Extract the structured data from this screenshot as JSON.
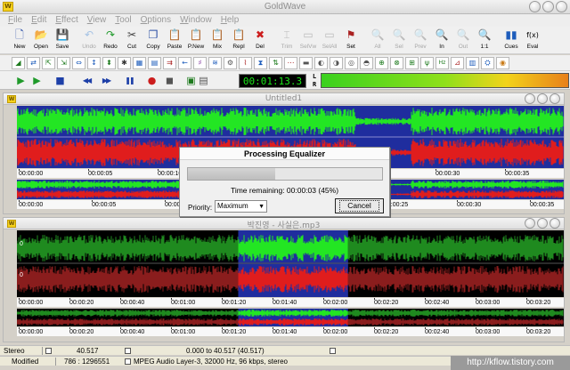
{
  "window": {
    "title": "GoldWave",
    "logo_text": "W"
  },
  "menu": [
    "File",
    "Edit",
    "Effect",
    "View",
    "Tool",
    "Options",
    "Window",
    "Help"
  ],
  "toolbar": [
    {
      "label": "New",
      "icon": "new-file-icon",
      "glyph": "🗋",
      "color": "#2c4fa8",
      "enabled": true
    },
    {
      "label": "Open",
      "icon": "open-folder-icon",
      "glyph": "📂",
      "color": "#d3a322",
      "enabled": true
    },
    {
      "label": "Save",
      "icon": "save-disk-icon",
      "glyph": "💾",
      "color": "#2b4fa5",
      "enabled": true
    },
    {
      "sep": true
    },
    {
      "label": "Undo",
      "icon": "undo-icon",
      "glyph": "↶",
      "color": "#1a6fd0",
      "enabled": false
    },
    {
      "label": "Redo",
      "icon": "redo-icon",
      "glyph": "↷",
      "color": "#1f9a2a",
      "enabled": true
    },
    {
      "label": "Cut",
      "icon": "scissors-icon",
      "glyph": "✂",
      "color": "#444444",
      "enabled": true
    },
    {
      "label": "Copy",
      "icon": "copy-icon",
      "glyph": "❐",
      "color": "#2b4fa5",
      "enabled": true
    },
    {
      "label": "Paste",
      "icon": "paste-icon",
      "glyph": "📋",
      "color": "#b87b25",
      "enabled": true
    },
    {
      "label": "P.New",
      "icon": "paste-new-icon",
      "glyph": "📋",
      "color": "#b87b25",
      "enabled": true
    },
    {
      "label": "Mix",
      "icon": "mix-icon",
      "glyph": "📋",
      "color": "#b03060",
      "enabled": true
    },
    {
      "label": "Repl",
      "icon": "replace-icon",
      "glyph": "📋",
      "color": "#7b2d9a",
      "enabled": true
    },
    {
      "label": "Del",
      "icon": "delete-icon",
      "glyph": "✖",
      "color": "#cc1d1d",
      "enabled": true
    },
    {
      "sep": true
    },
    {
      "label": "Trim",
      "icon": "trim-icon",
      "glyph": "⌶",
      "color": "#555555",
      "enabled": false
    },
    {
      "label": "SelVw",
      "icon": "select-view-icon",
      "glyph": "▭",
      "color": "#555555",
      "enabled": false
    },
    {
      "label": "SelAll",
      "icon": "select-all-icon",
      "glyph": "▭",
      "color": "#555555",
      "enabled": false
    },
    {
      "label": "Set",
      "icon": "set-marker-icon",
      "glyph": "⚑",
      "color": "#aa2222",
      "enabled": true
    },
    {
      "sep": true
    },
    {
      "label": "All",
      "icon": "zoom-all-icon",
      "glyph": "🔍",
      "color": "#555555",
      "enabled": false
    },
    {
      "label": "Sel",
      "icon": "zoom-selection-icon",
      "glyph": "🔍",
      "color": "#555555",
      "enabled": false
    },
    {
      "label": "Prev",
      "icon": "zoom-previous-icon",
      "glyph": "🔍",
      "color": "#555555",
      "enabled": false
    },
    {
      "label": "In",
      "icon": "zoom-in-icon",
      "glyph": "🔍",
      "color": "#1d5cbb",
      "enabled": true
    },
    {
      "label": "Out",
      "icon": "zoom-out-icon",
      "glyph": "🔍",
      "color": "#555555",
      "enabled": false
    },
    {
      "label": "1:1",
      "icon": "zoom-one-to-one-icon",
      "glyph": "🔍",
      "color": "#1d5cbb",
      "enabled": true
    },
    {
      "sep": true
    },
    {
      "label": "Cues",
      "icon": "cues-icon",
      "glyph": "▮▮",
      "color": "#1d5cbb",
      "enabled": true
    },
    {
      "label": "Eval",
      "icon": "eval-icon",
      "glyph": "f(x)",
      "color": "#000000",
      "enabled": true
    }
  ],
  "effects": [
    {
      "icon": "volume-icon",
      "glyph": "◢",
      "color": "#1d7a1d"
    },
    {
      "icon": "swap-icon",
      "glyph": "⇄",
      "color": "#1d5cbb"
    },
    {
      "icon": "fade-in-icon",
      "glyph": "⇱",
      "color": "#1d7a1d"
    },
    {
      "icon": "fade-out-icon",
      "glyph": "⇲",
      "color": "#1d7a1d"
    },
    {
      "icon": "stretch-icon",
      "glyph": "⇔",
      "color": "#1d5cbb"
    },
    {
      "icon": "offset-icon",
      "glyph": "↕",
      "color": "#1d5cbb"
    },
    {
      "icon": "normalize-icon",
      "glyph": "⬍",
      "color": "#1d7a1d"
    },
    {
      "icon": "noise-icon",
      "glyph": "✱",
      "color": "#333333"
    },
    {
      "icon": "equalizer-icon",
      "glyph": "▦",
      "color": "#1d5cbb"
    },
    {
      "icon": "filter-icon",
      "glyph": "▤",
      "color": "#1d5cbb"
    },
    {
      "icon": "doppler-icon",
      "glyph": "⇉",
      "color": "#aa2222"
    },
    {
      "icon": "reverse-icon",
      "glyph": "←",
      "color": "#1d5cbb"
    },
    {
      "icon": "pitch-icon",
      "glyph": "♯",
      "color": "#7b2d9a"
    },
    {
      "icon": "echo-icon",
      "glyph": "≋",
      "color": "#1d5cbb"
    },
    {
      "icon": "mechanize-icon",
      "glyph": "⚙",
      "color": "#555555"
    },
    {
      "icon": "interpolate-icon",
      "glyph": "⌇",
      "color": "#aa2222"
    },
    {
      "icon": "compressor-icon",
      "glyph": "⧗",
      "color": "#1d5cbb"
    },
    {
      "icon": "invert-icon",
      "glyph": "⇅",
      "color": "#1d7a1d"
    },
    {
      "icon": "resample-icon",
      "glyph": "⋯",
      "color": "#aa2222"
    },
    {
      "icon": "silence-icon",
      "glyph": "▬",
      "color": "#555555"
    },
    {
      "icon": "mono-icon",
      "glyph": "◐",
      "color": "#555555"
    },
    {
      "icon": "stereo-icon",
      "glyph": "◑",
      "color": "#555555"
    },
    {
      "icon": "spatial-icon",
      "glyph": "◎",
      "color": "#555555"
    },
    {
      "icon": "pan-icon",
      "glyph": "◓",
      "color": "#555555"
    },
    {
      "icon": "channel-mixer-icon",
      "glyph": "⊕",
      "color": "#1d7a1d"
    },
    {
      "icon": "auto-gain-icon",
      "glyph": "⊗",
      "color": "#1d7a1d"
    },
    {
      "icon": "dynamics-icon",
      "glyph": "⊞",
      "color": "#1d7a1d"
    },
    {
      "icon": "declick-icon",
      "glyph": "ψ",
      "color": "#1d7a1d"
    },
    {
      "icon": "hz-icon",
      "glyph": "Hz",
      "color": "#1d7a1d"
    },
    {
      "icon": "reduce-noise-icon",
      "glyph": "⊿",
      "color": "#aa2222"
    },
    {
      "icon": "spectrum-icon",
      "glyph": "▥",
      "color": "#1d5cbb"
    },
    {
      "icon": "flanger-icon",
      "glyph": "⛭",
      "color": "#1d5cbb"
    },
    {
      "icon": "speed-icon",
      "glyph": "◉",
      "color": "#c97a16"
    }
  ],
  "transport": {
    "buttons": [
      {
        "icon": "play-icon",
        "glyph": "▶",
        "color": "#1f9a2a"
      },
      {
        "icon": "play-selection-icon",
        "glyph": "▶",
        "color": "#1f9a2a"
      },
      {
        "icon": "stop-icon",
        "glyph": "■",
        "color": "#1d3fa8"
      },
      {
        "icon": "rewind-icon",
        "glyph": "◀◀",
        "color": "#1d3fa8"
      },
      {
        "icon": "fast-forward-icon",
        "glyph": "▶▶",
        "color": "#1d3fa8"
      },
      {
        "icon": "pause-icon",
        "glyph": "❚❚",
        "color": "#1d3fa8"
      },
      {
        "icon": "record-icon",
        "glyph": "●",
        "color": "#cc1d1d"
      },
      {
        "icon": "record-selection-icon",
        "glyph": "◼",
        "color": "#555555"
      },
      {
        "icon": "monitor-icon",
        "glyph": "▣",
        "color": "#1d7a1d"
      },
      {
        "icon": "properties-icon",
        "glyph": "▤",
        "color": "#555555"
      }
    ],
    "time": "00:01:13.3",
    "meter_labels": [
      "L",
      "R"
    ],
    "meter_level": 0.35
  },
  "doc1": {
    "title": "Untitled1",
    "ticks": [
      "00:00:00",
      "00:00:05",
      "00:00:10",
      "00:00:15",
      "00:00:20",
      "00:00:25",
      "00:00:30",
      "00:00:35",
      "00:00:40"
    ],
    "overview_ticks": [
      "00:00:00",
      "00:00:05",
      "00:00:10",
      "00:00:15",
      "00:00:20",
      "00:00:25",
      "00:00:30",
      "00:00:35"
    ],
    "colors": {
      "background": "#1f2d9e",
      "left": "#23e623",
      "right": "#e01d1d",
      "ruler": "#f8f8f8"
    }
  },
  "doc2": {
    "title": "박진영 - 사실은.mp3",
    "zero_labels": [
      "0",
      "0"
    ],
    "ticks": [
      "00:00:00",
      "00:00:20",
      "00:00:40",
      "00:01:00",
      "00:01:20",
      "00:01:40",
      "00:02:00",
      "00:02:20",
      "00:02:40",
      "00:03:00",
      "00:03:20"
    ],
    "overview_ticks": [
      "00:00:00",
      "00:00:20",
      "00:00:40",
      "00:01:00",
      "00:01:20",
      "00:01:40",
      "00:02:00",
      "00:02:20",
      "00:02:40",
      "00:03:00",
      "00:03:20"
    ],
    "selection": {
      "start_sec": 40.517,
      "end_sec": 81.0
    },
    "duration_sec": 210,
    "colors": {
      "background": "#000000",
      "selected": "#1f2d9e",
      "left": "#1f8a1f",
      "right": "#8a1d1d",
      "left_sel": "#23e623",
      "right_sel": "#e01d1d"
    }
  },
  "dialog": {
    "title": "Processing Equalizer",
    "progress": 0.45,
    "remaining": "Time remaining: 00:00:03 (45%)",
    "priority_label": "Priority:",
    "priority_value": "Maximum",
    "cancel_label": "Cancel"
  },
  "status": {
    "channels": "Stereo",
    "length": "40.517",
    "selection": "0.000 to 40.517 (40.517)",
    "state": "Modified",
    "ratio": "786 : 1296551",
    "format": "MPEG Audio Layer-3, 32000 Hz, 96 kbps, stereo"
  },
  "watermark": "http://kflow.tistory.com"
}
